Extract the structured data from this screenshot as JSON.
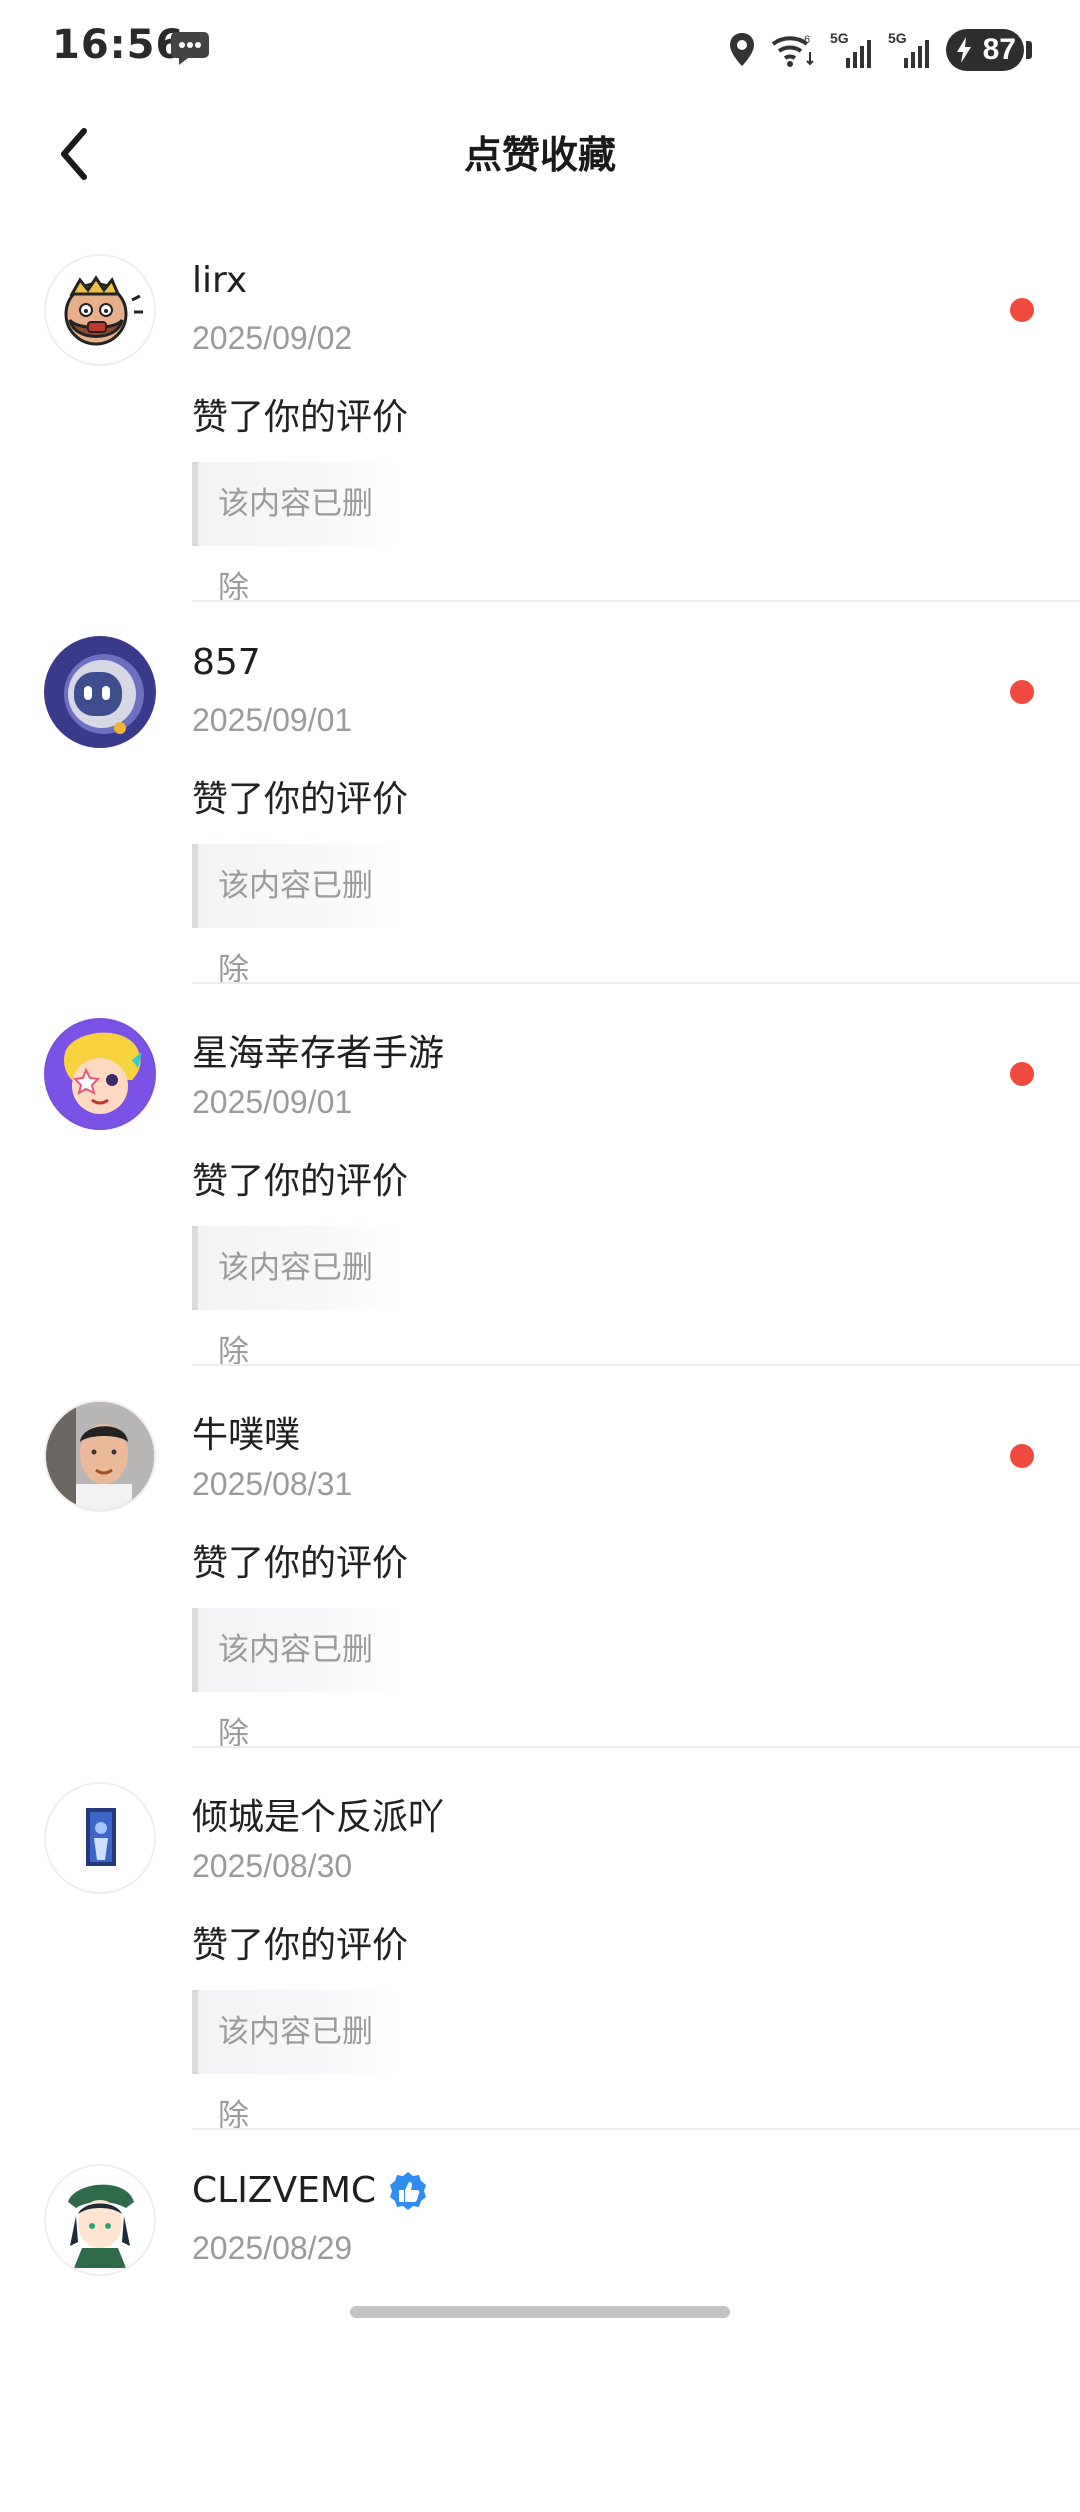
{
  "status_bar": {
    "time": "16:56",
    "network_1": "5G",
    "network_2": "5G",
    "battery": "87",
    "icons": [
      "message-icon",
      "location-icon",
      "wifi-icon",
      "signal-icon",
      "signal-icon",
      "battery-icon"
    ]
  },
  "header": {
    "title": "点赞收藏",
    "back_icon": "chevron-left-icon"
  },
  "notifications": [
    {
      "name": "lirx",
      "date": "2025/09/02",
      "action": "赞了你的评价",
      "quote": "该内容已删除",
      "unread": true
    },
    {
      "name": "857",
      "date": "2025/09/01",
      "action": "赞了你的评价",
      "quote": "该内容已删除",
      "unread": true
    },
    {
      "name": "星海幸存者手游",
      "date": "2025/09/01",
      "action": "赞了你的评价",
      "quote": "该内容已删除",
      "unread": true
    },
    {
      "name": "牛噗噗",
      "date": "2025/08/31",
      "action": "赞了你的评价",
      "quote": "该内容已删除",
      "unread": true
    },
    {
      "name": "倾城是个反派吖",
      "date": "2025/08/30",
      "action": "赞了你的评价",
      "quote": "该内容已删除",
      "unread": false
    },
    {
      "name": "CLIZVEMC",
      "date": "2025/08/29",
      "verified_icon": "thumbs-up-badge-icon",
      "unread": false
    }
  ],
  "colors": {
    "unread_dot": "#f04a3e",
    "verified_badge": "#2f8cf0",
    "date_text": "#9a9a9a"
  }
}
